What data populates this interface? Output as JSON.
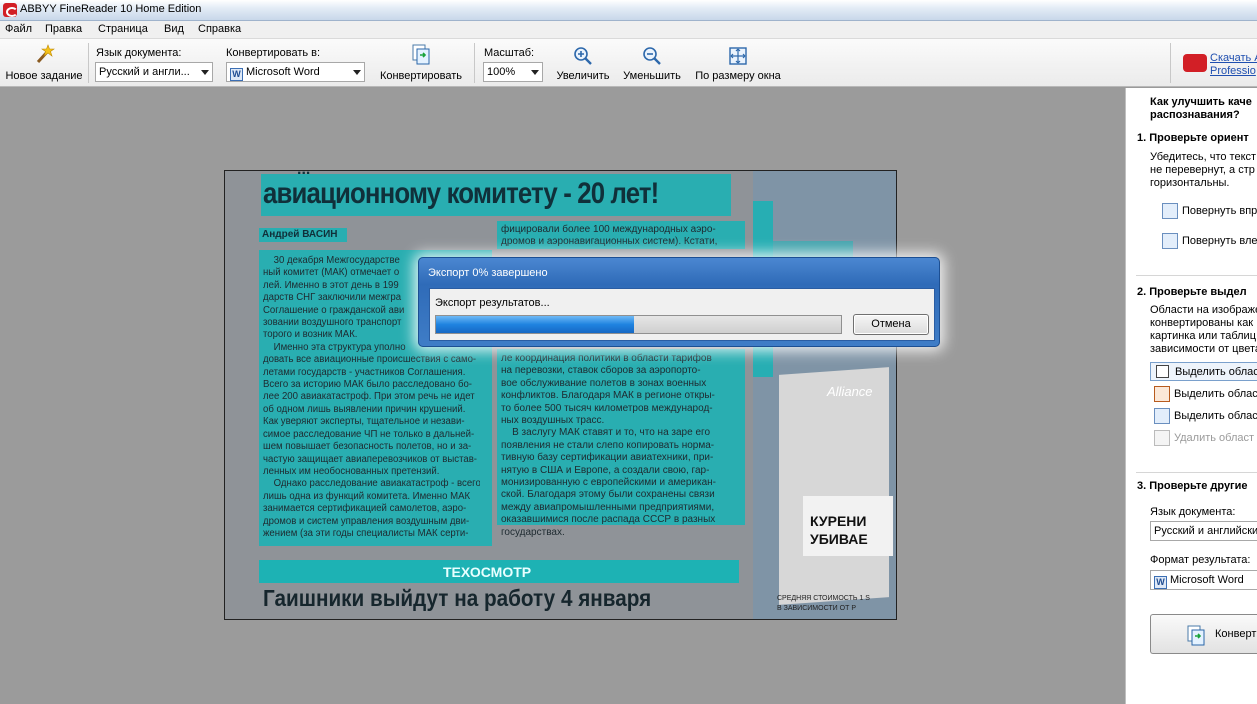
{
  "window": {
    "title": "ABBYY FineReader 10 Home Edition"
  },
  "menu": [
    "Файл",
    "Правка",
    "Страница",
    "Вид",
    "Справка"
  ],
  "toolbar": {
    "new_task": "Новое задание",
    "doc_lang_label": "Язык документа:",
    "doc_lang_value": "Русский и англи...",
    "convert_to_label": "Конвертировать в:",
    "convert_to_value": "Microsoft Word",
    "convert_button": "Конвертировать",
    "scale_label": "Масштаб:",
    "scale_value": "100%",
    "zoom_in": "Увеличить",
    "zoom_out": "Уменьшить",
    "fit_window": "По размеру окна",
    "promo_line1": "Скачать А",
    "promo_line2": "Professio"
  },
  "document": {
    "headline_partial": "...",
    "headline": "авиационному комитету - 20 лет!",
    "byline": "Андрей ВАСИН",
    "col1": "    30 декабря Межгосударстве\nный комитет (МАК) отмечает о\nлей. Именно в этот день в 199\nдарств СНГ заключили межгра\nСоглашение о гражданской ави\nзовании воздушного транспорт\nторого и возник МАК.\n    Именно эта структура уполно\nдовать все авиационные происшествия с само-\nлетами государств - участников Соглашения.\nВсего за историю МАК было расследовано бо-\nлее 200 авиакатастроф. При этом речь не идет\nоб одном лишь выявлении причин крушений.\nКак уверяют эксперты, тщательное и незави-\nсимое расследование ЧП не только в дальней-\nшем повышает безопасность полетов, но и за-\nчастую защищает авиаперевозчиков от выстав-\nленных им необоснованных претензий.\n    Однако расследование авиакатастроф - всего\nлишь одна из функций комитета. Именно МАК\nзанимается сертификацией самолетов, аэро-\nдромов и систем управления воздушным дви-\nжением (за эти годы специалисты МАК серти-",
    "col2_top": "фицировали более 100 международных аэро-\nдромов и аэронавигационных систем). Кстати,",
    "col2": "ле координация политики в области тарифов\nна перевозки, ставок сборов за аэропорто-\nвое обслуживание полетов в зонах военных\nконфликтов. Благодаря МАК в регионе откры-\nто более 500 тысяч километров международ-\nных воздушных трасс.\n    В заслугу МАК ставят и то, что на заре его\nпоявления не стали слепо копировать норма-\nтивную базу сертификации авиатехники, при-\nнятую в США и Европе, а создали свою, гар-\nмонизированную с европейскими и американ-\nской. Благодаря этому были сохранены связи\nмежду авиапромышленными предприятиями,\nоказавшимися после распада СССР в разных\nгосударствах.",
    "section_bar": "ТЕХОСМОТР",
    "headline2": "Гаишники выйдут на работу 4 января",
    "ad_brand": "Alliance",
    "ad_warning_1": "КУРЕНИ",
    "ad_warning_2": "УБИВАЕ",
    "ad_price": "СРЕДНЯЯ СТОИМОСТЬ 1 S",
    "ad_price2": "В ЗАВИСИМОСТИ ОТ Р"
  },
  "dialog": {
    "title": "Экспорт 0% завершено",
    "message": "Экспорт результатов...",
    "progress": 0.49,
    "cancel": "Отмена"
  },
  "panel": {
    "heading": "Как улучшить каче",
    "heading2": "распознавания?",
    "s1_title": "1. Проверьте ориент",
    "s1_text1": "Убедитесь, что текст",
    "s1_text2": "не перевернут, а стр",
    "s1_text3": "горизонтальны.",
    "rotate_right": "Повернуть впр",
    "rotate_left": "Повернуть вле",
    "s2_title": "2. Проверьте выдел",
    "s2_text1": "Области на изображе",
    "s2_text2": "конвертированы как",
    "s2_text3": "картинка или таблиц",
    "s2_text4": "зависимости от цвета",
    "select_area_1": "Выделить облас",
    "select_area_2": "Выделить облас",
    "select_area_3": "Выделить облас",
    "delete_areas": "Удалить област",
    "s3_title": "3. Проверьте другие",
    "lang_label": "Язык документа:",
    "lang_value": "Русский и английски",
    "format_label": "Формат результата:",
    "format_value": "Microsoft Word",
    "convert_button": "Конверт"
  },
  "colors": {
    "highlight": "#17b3b5",
    "dialog_title": "#2f6bb8",
    "progress": "#1f83e0"
  }
}
